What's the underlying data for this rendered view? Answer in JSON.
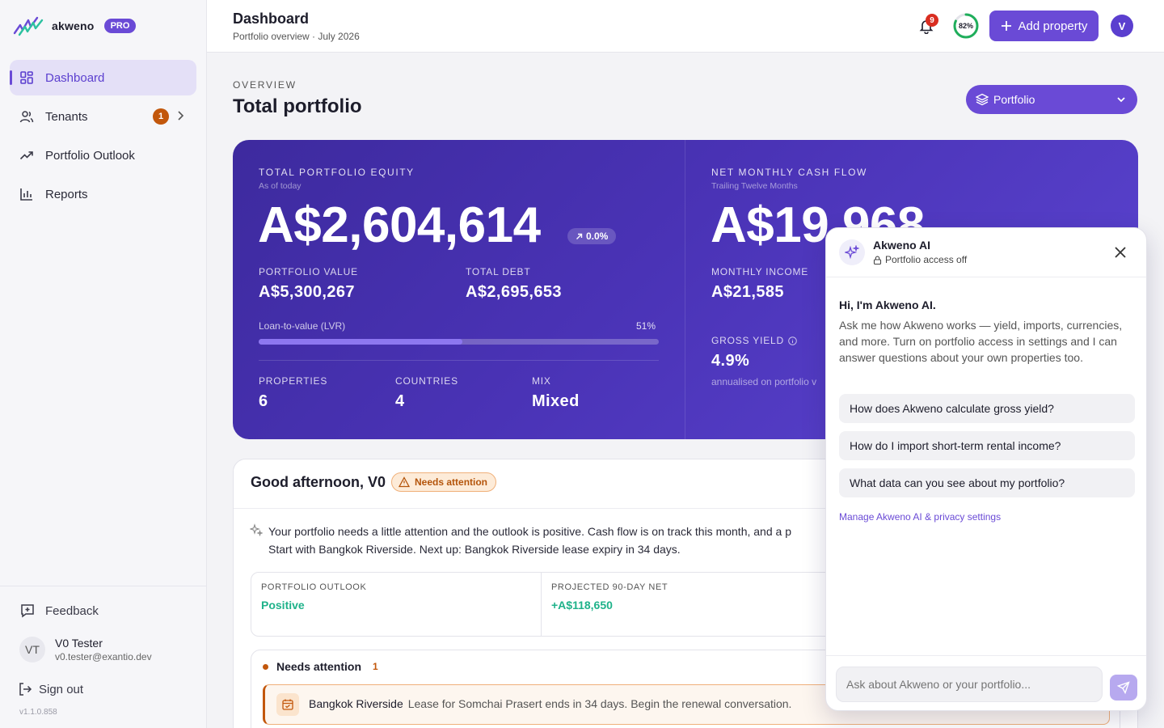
{
  "brand": {
    "name": "akweno",
    "tier": "PRO"
  },
  "sidebar": {
    "items": [
      {
        "label": "Dashboard",
        "icon": "grid-icon",
        "active": true
      },
      {
        "label": "Tenants",
        "icon": "users-icon",
        "badge": "1"
      },
      {
        "label": "Portfolio Outlook",
        "icon": "trend-icon"
      },
      {
        "label": "Reports",
        "icon": "bar-chart-icon"
      }
    ],
    "feedback": "Feedback",
    "user": {
      "initials": "VT",
      "name": "V0 Tester",
      "email": "v0.tester@exantio.dev"
    },
    "signout": "Sign out",
    "version": "v1.1.0.858"
  },
  "header": {
    "title": "Dashboard",
    "subtitle": "Portfolio overview · July 2026",
    "notifications": "9",
    "completion": "82%",
    "completion_value": 0.82,
    "add_label": "Add property",
    "avatar": "V"
  },
  "overview": {
    "eyebrow": "OVERVIEW",
    "title": "Total portfolio",
    "selector": "Portfolio"
  },
  "hero": {
    "equity_label": "TOTAL PORTFOLIO EQUITY",
    "equity_sub": "As of today",
    "equity_value": "A$2,604,614",
    "equity_change": "0.0%",
    "portfolio_value_label": "PORTFOLIO VALUE",
    "portfolio_value": "A$5,300,267",
    "debt_label": "TOTAL DEBT",
    "debt_value": "A$2,695,653",
    "lvr_label": "Loan-to-value (LVR)",
    "lvr_pct": "51%",
    "lvr_value": 0.51,
    "properties_label": "PROPERTIES",
    "properties_value": "6",
    "countries_label": "COUNTRIES",
    "countries_value": "4",
    "mix_label": "MIX",
    "mix_value": "Mixed",
    "cash_label": "NET MONTHLY CASH FLOW",
    "cash_sub": "Trailing Twelve Months",
    "cash_value": "A$19,968",
    "income_label": "MONTHLY INCOME",
    "income_value": "A$21,585",
    "yield_label": "GROSS YIELD",
    "yield_value": "4.9%",
    "yield_note": "annualised on portfolio v"
  },
  "greeting": {
    "title": "Good afternoon, V0",
    "badge": "Needs attention",
    "summary_line1": "Your portfolio needs a little attention and the outlook is positive. Cash flow is on track this month, and a p",
    "summary_line2": "Start with Bangkok Riverside. Next up: Bangkok Riverside lease expiry in 34 days.",
    "metrics": [
      {
        "label": "PORTFOLIO OUTLOOK",
        "value": "Positive"
      },
      {
        "label": "PROJECTED 90-DAY NET",
        "value": "+A$118,650"
      }
    ],
    "attention_title": "Needs attention",
    "attention_count": "1",
    "attention_item_property": "Bangkok Riverside",
    "attention_item_text": "Lease for Somchai Prasert ends in 34 days. Begin the renewal conversation."
  },
  "chat": {
    "title": "Akweno AI",
    "status": "Portfolio access off",
    "greeting": "Hi, I'm Akweno AI.",
    "intro": "Ask me how Akweno works — yield, imports, currencies, and more. Turn on portfolio access in settings and I can answer questions about your own properties too.",
    "suggestions": [
      "How does Akweno calculate gross yield?",
      "How do I import short-term rental income?",
      "What data can you see about my portfolio?"
    ],
    "link": "Manage Akweno AI & privacy settings",
    "placeholder": "Ask about Akweno or your portfolio..."
  },
  "colors": {
    "accent": "#6a4ad6",
    "attention": "#c2570c",
    "positive": "#1fb28a",
    "alert": "#d92d20"
  }
}
